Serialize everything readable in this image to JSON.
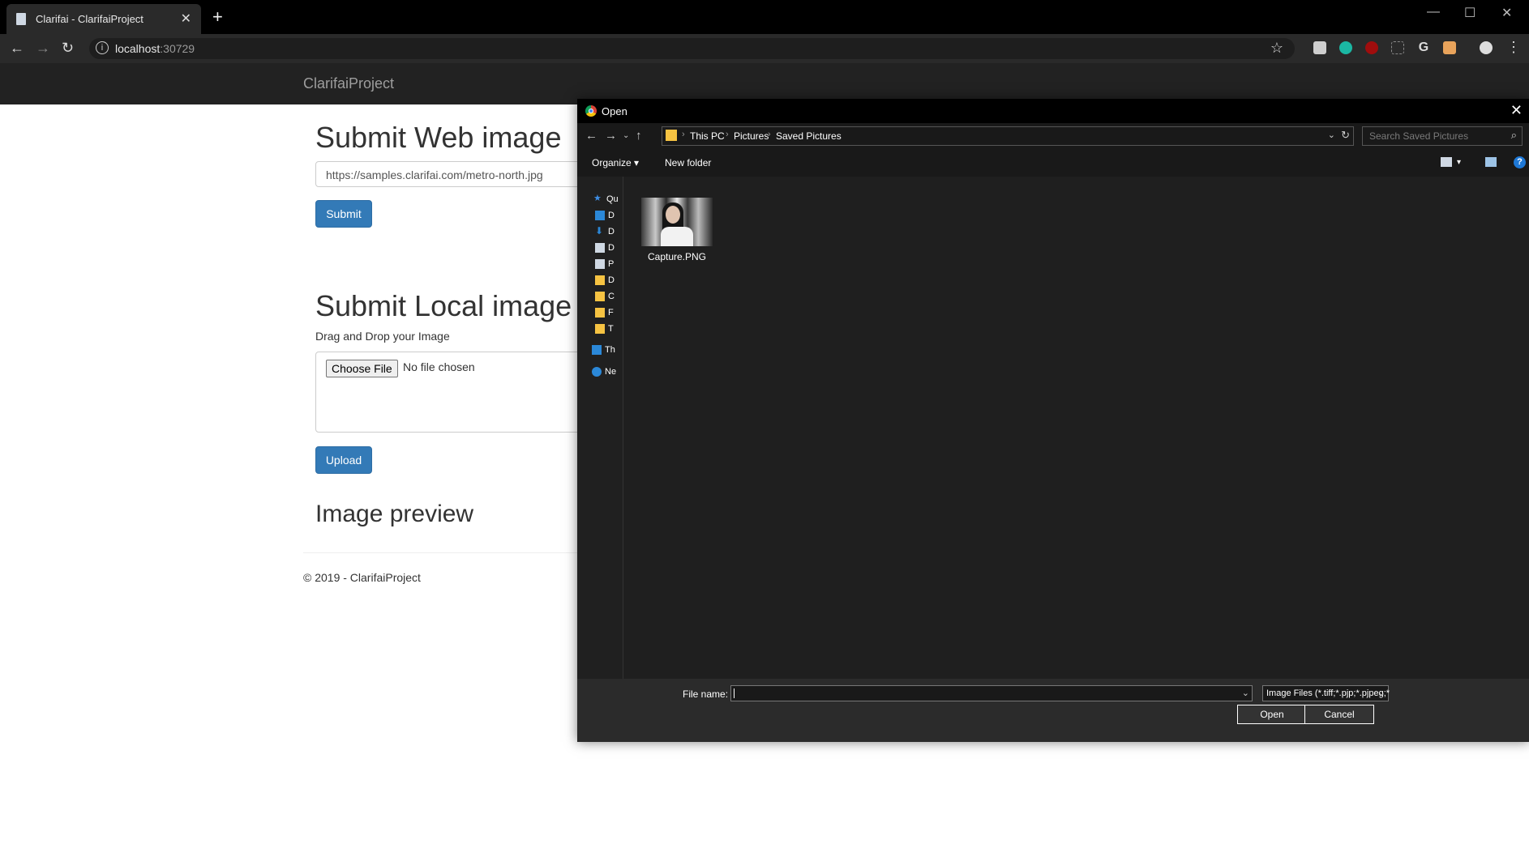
{
  "browser": {
    "tab_title": "Clarifai - ClarifaiProject",
    "new_tab": "+",
    "url_host": "localhost",
    "url_port": ":30729",
    "window_controls": [
      "—",
      "☐",
      "✕"
    ]
  },
  "navbar": {
    "brand": "ClarifaiProject"
  },
  "web_section": {
    "heading": "Submit Web image",
    "url_value": "https://samples.clarifai.com/metro-north.jpg",
    "submit_label": "Submit"
  },
  "local_section": {
    "heading": "Submit Local image",
    "drag_label": "Drag and Drop your Image",
    "choose_file_label": "Choose File",
    "no_file_text": "No file chosen",
    "upload_label": "Upload"
  },
  "preview_section": {
    "heading": "Image preview"
  },
  "footer": {
    "text": "© 2019 - ClarifaiProject"
  },
  "dialog": {
    "title": "Open",
    "breadcrumb": [
      "This PC",
      "Pictures",
      "Saved Pictures"
    ],
    "search_placeholder": "Search Saved Pictures",
    "organize_label": "Organize",
    "new_folder_label": "New folder",
    "nav_items": [
      {
        "label": "Qu",
        "icon": "star-icon",
        "color": "#3d8ee6"
      },
      {
        "label": "D",
        "icon": "desktop-icon",
        "color": "#2b88d8"
      },
      {
        "label": "D",
        "icon": "download-icon",
        "color": "#2b88d8"
      },
      {
        "label": "D",
        "icon": "document-icon",
        "color": "#cfd8e3"
      },
      {
        "label": "P",
        "icon": "pictures-icon",
        "color": "#cfd8e3"
      },
      {
        "label": "D",
        "icon": "folder-icon",
        "color": "#f6c342"
      },
      {
        "label": "C",
        "icon": "folder-icon",
        "color": "#f6c342"
      },
      {
        "label": "F",
        "icon": "folder-icon",
        "color": "#f6c342"
      },
      {
        "label": "T",
        "icon": "folder-icon",
        "color": "#f6c342"
      },
      {
        "label": "Th",
        "icon": "this-pc-icon",
        "color": "#2b88d8"
      },
      {
        "label": "Ne",
        "icon": "network-icon",
        "color": "#2b88d8"
      }
    ],
    "file": {
      "name": "Capture.PNG"
    },
    "file_name_label": "File name:",
    "file_name_value": "",
    "filter_value": "Image Files (*.tiff;*.pjp;*.pjpeg;*",
    "open_label": "Open",
    "cancel_label": "Cancel"
  },
  "colors": {
    "primary": "#337ab7",
    "navbar_bg": "#222222",
    "dialog_bg": "#2b2b2b"
  }
}
